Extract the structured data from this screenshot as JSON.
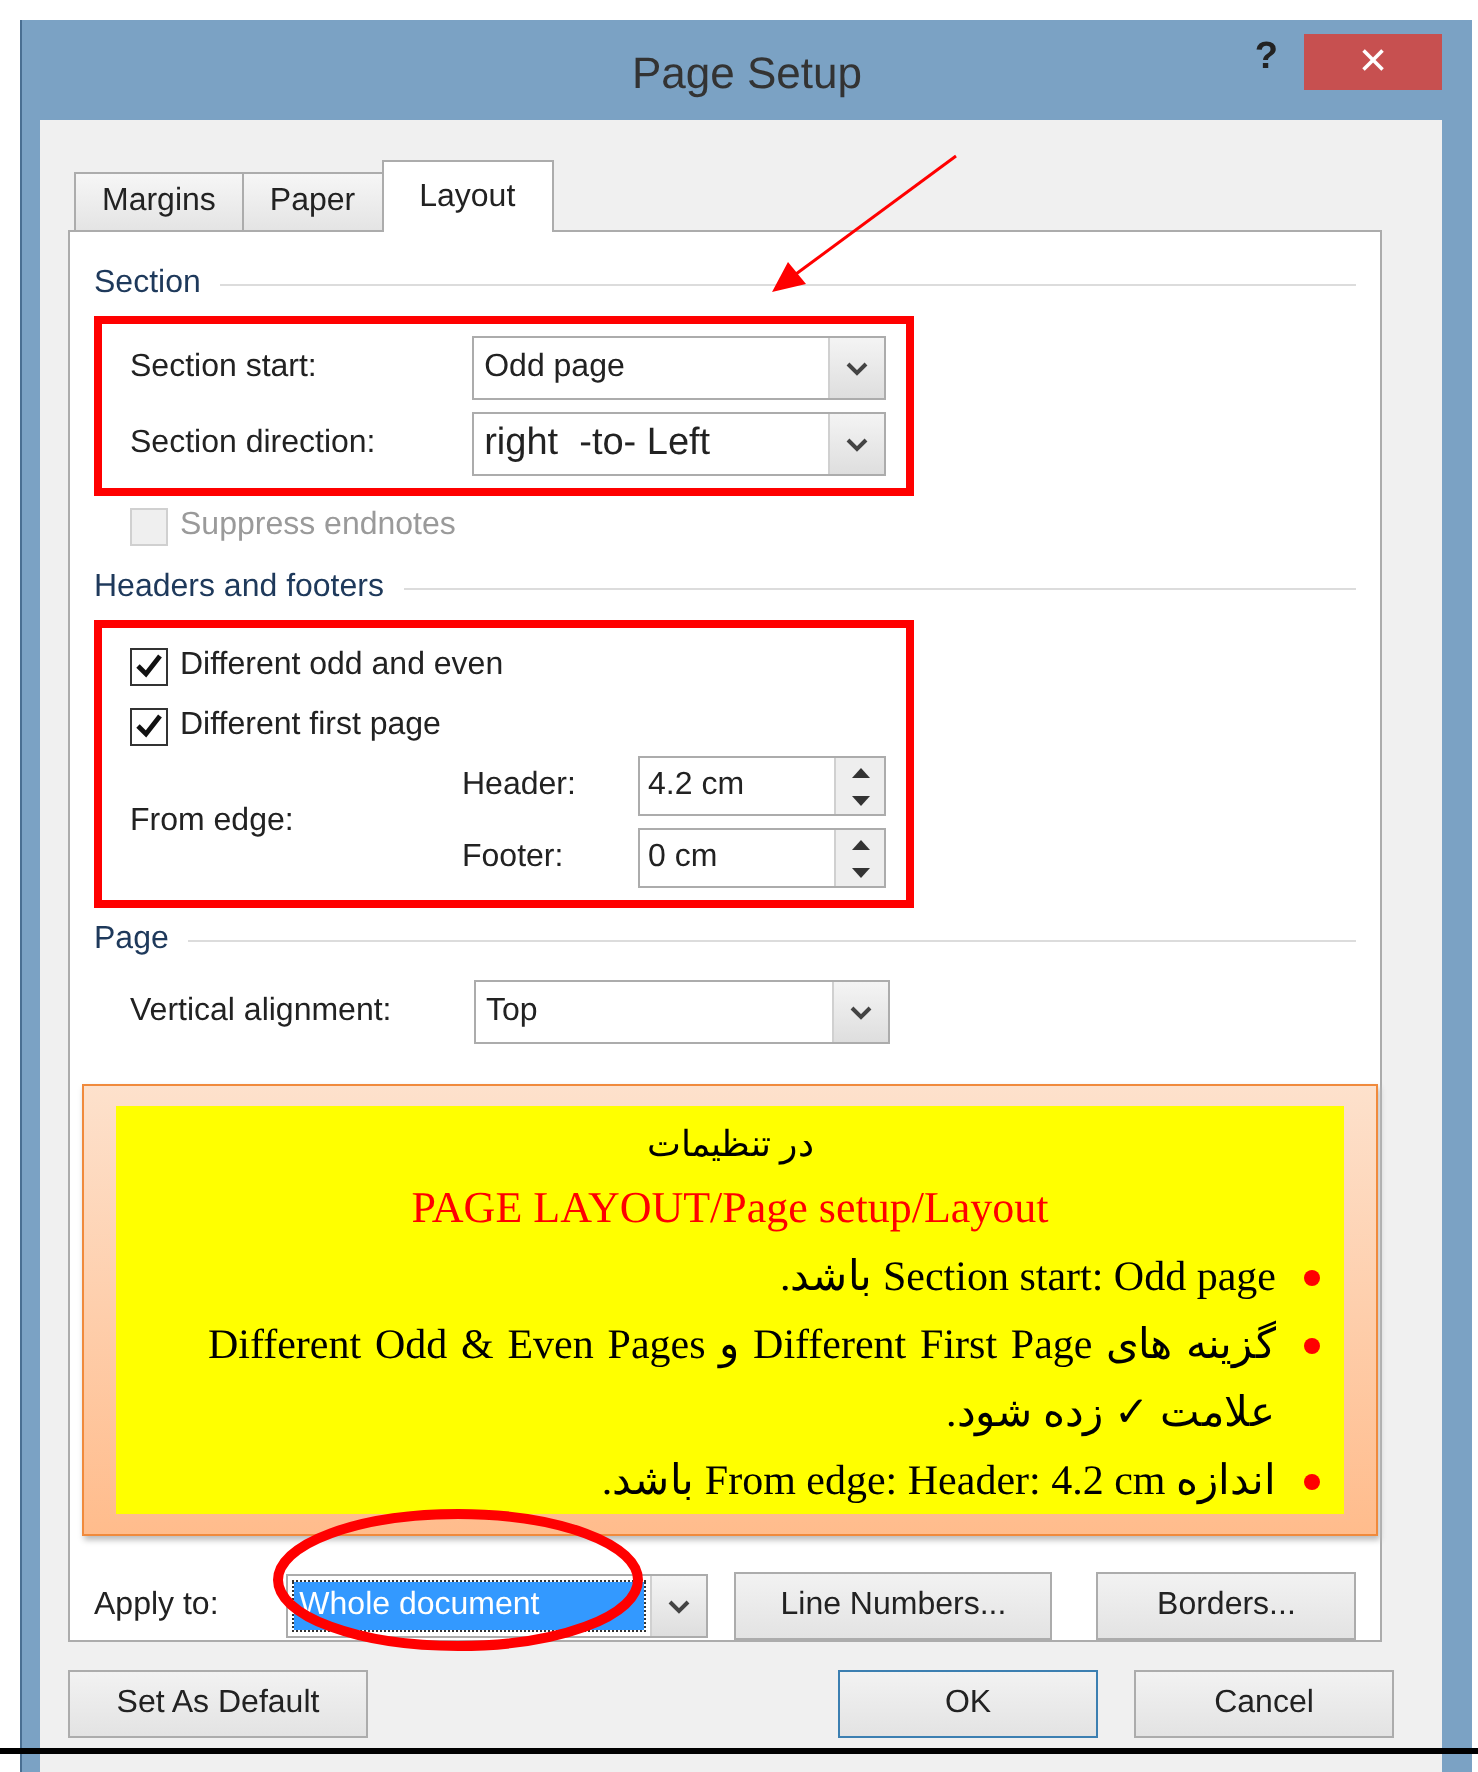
{
  "window": {
    "title": "Page Setup",
    "help": "?",
    "close": "×"
  },
  "tabs": [
    {
      "label": "Margins",
      "selected": false
    },
    {
      "label": "Paper",
      "selected": false
    },
    {
      "label": "Layout",
      "selected": true
    }
  ],
  "section": {
    "heading": "Section",
    "fields": [
      {
        "label": "Section start:",
        "value": "Odd page"
      },
      {
        "label": "Section direction:",
        "value": "right  -to- Left"
      }
    ],
    "suppress_endnotes": {
      "label": "Suppress endnotes",
      "checked": false,
      "disabled": true
    }
  },
  "headers_footers": {
    "heading": "Headers and footers",
    "checkboxes": [
      {
        "label": "Different odd and even",
        "checked": true,
        "disabled": false
      },
      {
        "label": "Different first page",
        "checked": true,
        "disabled": false
      }
    ],
    "from_edge": {
      "label": "From edge:",
      "spinners": [
        {
          "label": "Header:",
          "value": "4.2 cm"
        },
        {
          "label": "Footer:",
          "value": "0 cm"
        }
      ]
    }
  },
  "page": {
    "heading": "Page",
    "vertical_alignment": {
      "label": "Vertical alignment:",
      "value": "Top"
    }
  },
  "note": {
    "title": "در تنظیمات",
    "path": "PAGE LAYOUT/Page setup/Layout",
    "bullets": [
      "Section start: Odd page باشد.",
      "گزینه های  Different First Page و  Different Odd & Even Pages علامت ✓ زده شود.",
      "اندازه From edge: Header: 4.2 cm باشد."
    ]
  },
  "apply_to": {
    "label": "Apply to:",
    "value": "Whole document",
    "selected": true
  },
  "panel_buttons": [
    "Line Numbers...",
    "Borders..."
  ],
  "buttons": [
    {
      "label": "Set As Default",
      "default": false
    },
    {
      "label": "OK",
      "default": true
    },
    {
      "label": "Cancel",
      "default": false
    }
  ]
}
